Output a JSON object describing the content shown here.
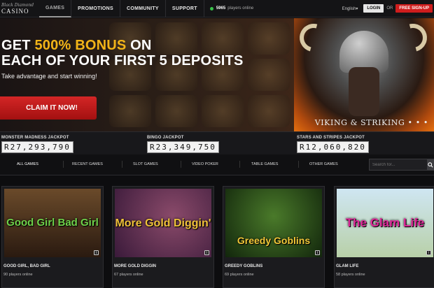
{
  "brand": {
    "line1": "Black Diamond",
    "line2": "CASINO"
  },
  "nav": [
    {
      "label": "GAMES"
    },
    {
      "label": "PROMOTIONS"
    },
    {
      "label": "COMMUNITY"
    },
    {
      "label": "SUPPORT"
    }
  ],
  "online": {
    "count": "5965",
    "text": "players online"
  },
  "header": {
    "language": "English",
    "login": "LOGIN",
    "or": "OR",
    "signup": "FREE SIGN-UP"
  },
  "hero": {
    "line1_pre": "GET ",
    "line1_highlight": "500% BONUS",
    "line1_post": " ON",
    "line2": "EACH OF YOUR FIRST 5 DEPOSITS",
    "subtitle": "Take advantage and start winning!",
    "cta": "CLAIM IT NOW!",
    "game_title": "VIKING & STRIKING",
    "dots": "• • •"
  },
  "jackpots": [
    {
      "title": "MONSTER MADNESS JACKPOT",
      "value": "R27,293,790"
    },
    {
      "title": "BINGO JACKPOT",
      "value": "R23,349,750"
    },
    {
      "title": "STARS AND STRIPES JACKPOT",
      "value": "R12,060,820"
    }
  ],
  "filters": [
    {
      "label": "ALL GAMES"
    },
    {
      "label": "RECENT GAMES"
    },
    {
      "label": "SLOT GAMES"
    },
    {
      "label": "VIDEO POKER"
    },
    {
      "label": "TABLE GAMES"
    },
    {
      "label": "OTHER GAMES"
    }
  ],
  "search": {
    "placeholder": "Search for..."
  },
  "games": [
    {
      "title": "Good Girl Bad Girl",
      "name": "GOOD GIRL, BAD GIRL",
      "players": "90 players online"
    },
    {
      "title": "More Gold Diggin'",
      "name": "MORE GOLD DIGGIN",
      "players": "67 players online"
    },
    {
      "title": "Greedy Goblins",
      "name": "GREEDY GOBLINS",
      "players": "69 players online"
    },
    {
      "title": "The Glam Life",
      "name": "GLAM LIFE",
      "players": "58 players online"
    }
  ],
  "colors": {
    "accent": "#cf1d1d",
    "gold": "#f2b418",
    "online": "#39c34a"
  },
  "icons": {
    "search": "search-icon",
    "info": "info-icon",
    "caret": "caret-down-icon"
  }
}
